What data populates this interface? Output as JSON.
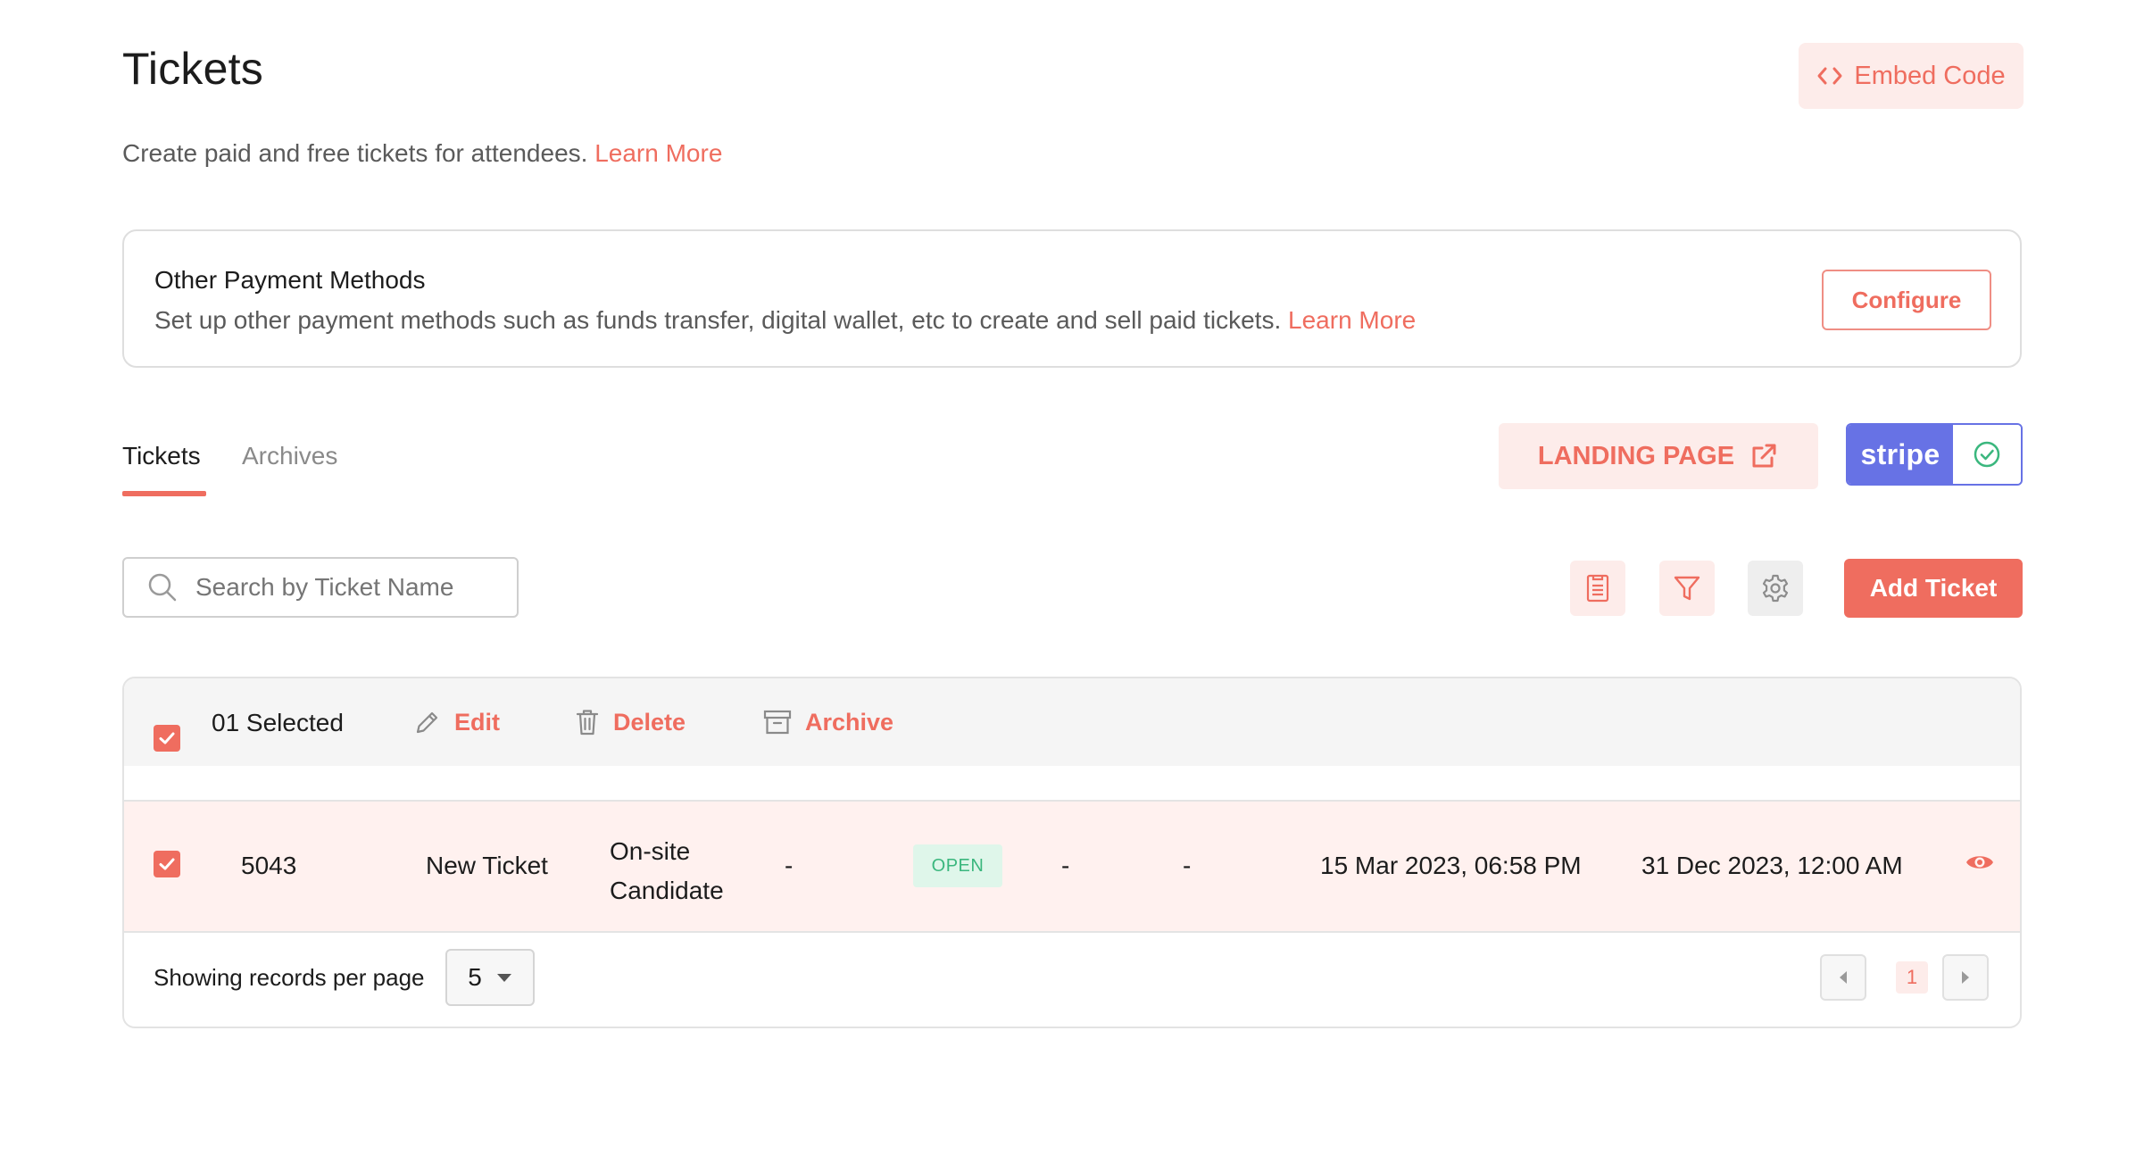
{
  "page": {
    "title": "Tickets",
    "subtitle": "Create paid and free tickets for attendees.",
    "subtitle_link": "Learn More",
    "embed_button": "Embed Code"
  },
  "payment_methods": {
    "title": "Other Payment Methods",
    "description": "Set up other payment methods such as funds transfer, digital wallet, etc to create and sell paid tickets.",
    "link": "Learn More",
    "configure_button": "Configure"
  },
  "tabs": [
    {
      "label": "Tickets",
      "active": true
    },
    {
      "label": "Archives",
      "active": false
    }
  ],
  "landing_page_button": "LANDING PAGE",
  "stripe": {
    "label": "stripe",
    "connected": true
  },
  "search": {
    "placeholder": "Search by Ticket Name",
    "value": ""
  },
  "toolbar": {
    "icons": [
      "clipboard-icon",
      "filter-icon",
      "gear-icon"
    ],
    "add_button": "Add Ticket"
  },
  "bulk_bar": {
    "selected_label": "01 Selected",
    "actions": [
      "Edit",
      "Delete",
      "Archive"
    ]
  },
  "rows": [
    {
      "selected": true,
      "id": "5043",
      "name": "New Ticket",
      "type_line1": "On-site",
      "type_line2": "Candidate",
      "col4": "-",
      "status": "OPEN",
      "col6": "-",
      "col7": "-",
      "start_date": "15 Mar 2023, 06:58 PM",
      "end_date": "31 Dec 2023, 12:00 AM"
    }
  ],
  "footer": {
    "per_page_label": "Showing records per page",
    "per_page_value": "5",
    "current_page": "1"
  },
  "colors": {
    "accent": "#ef6d5f",
    "accent_light": "#fdecea",
    "stripe": "#6772e5",
    "status_open_bg": "#dff6ea",
    "status_open_text": "#3bb77e"
  }
}
